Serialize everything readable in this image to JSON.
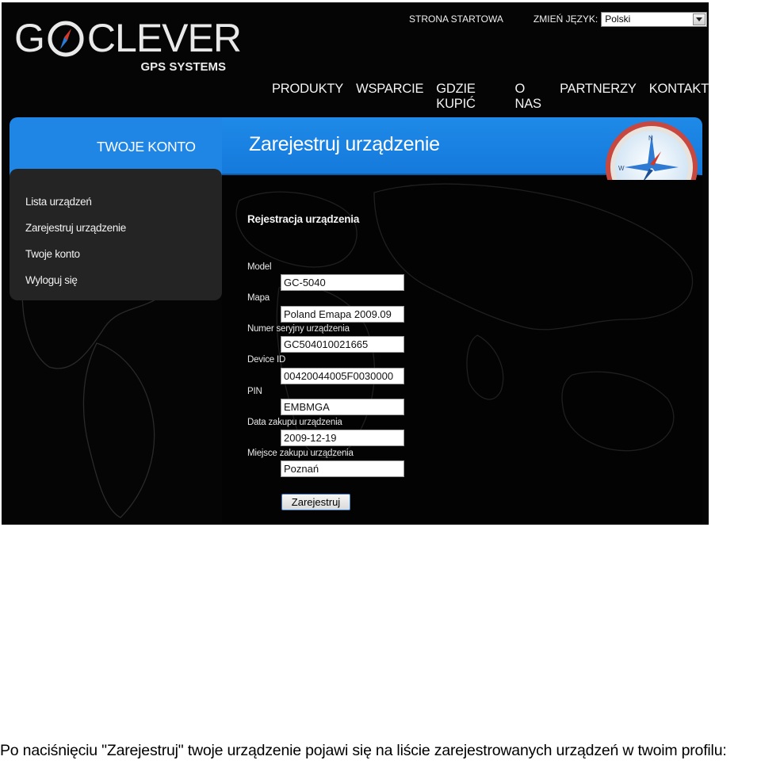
{
  "brand": {
    "logo_text_left": "G",
    "logo_text_right": "CLEVER",
    "logo_subtitle": "GPS SYSTEMS"
  },
  "top_links": {
    "home": "STRONA STARTOWA",
    "language_label": "ZMIEŃ JĘZYK:",
    "language_selected": "Polski"
  },
  "main_nav": [
    "PRODUKTY",
    "WSPARCIE",
    "GDZIE KUPIĆ",
    "O NAS",
    "PARTNERZY",
    "KONTAKT"
  ],
  "account_title": "TWOJE KONTO",
  "page_title": "Zarejestruj urządzenie",
  "sidebar": [
    "Lista urządzeń",
    "Zarejestruj urządzenie",
    "Twoje konto",
    "Wyloguj się"
  ],
  "form": {
    "title": "Rejestracja urządzenia",
    "fields": [
      {
        "label": "Model",
        "value": "GC-5040"
      },
      {
        "label": "Mapa",
        "value": "Poland Emapa 2009.09"
      },
      {
        "label": "Numer seryjny urządzenia",
        "value": "GC504010021665"
      },
      {
        "label": "Device ID",
        "value": "00420044005F0030000"
      },
      {
        "label": "PIN",
        "value": "EMBMGA"
      },
      {
        "label": "Data zakupu urządzenia",
        "value": "2009-12-19"
      },
      {
        "label": "Miejsce zakupu urządzenia",
        "value": "Poznań"
      }
    ],
    "submit_label": "Zarejestruj"
  },
  "caption": "Po naciśnięciu \"Zarejestruj\" twoje urządzenie pojawi się na liście zarejestrowanych urządzeń w twoim profilu:",
  "colors": {
    "background": "#050505",
    "accent_blue": "#1f86e6",
    "sidebar_bg": "#252424",
    "text_light": "#f2f2f2"
  },
  "icons": [
    "compass-icon",
    "dropdown-arrow-icon",
    "world-map"
  ]
}
